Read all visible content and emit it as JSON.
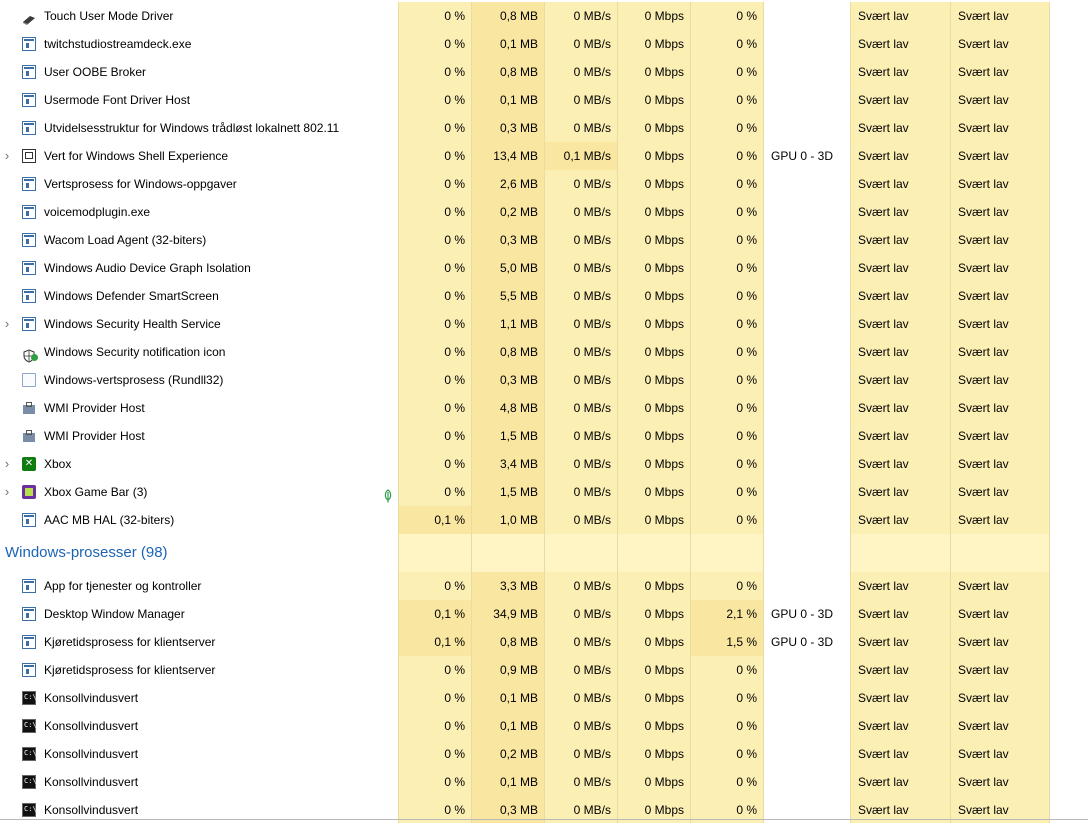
{
  "rows": [
    {
      "kind": "proc",
      "name": "Touch User Mode Driver",
      "icon": "pen-icon",
      "cpu": "0 %",
      "mem": "0,8 MB",
      "disk": "0 MB/s",
      "net": "0 Mbps",
      "gpu": "0 %",
      "engine": "",
      "power": "Svært lav",
      "power_trend": "Svært lav",
      "heat": [
        1,
        2,
        1,
        1,
        1
      ]
    },
    {
      "kind": "proc",
      "name": "twitchstudiostreamdeck.exe",
      "icon": "app-icon",
      "cpu": "0 %",
      "mem": "0,1 MB",
      "disk": "0 MB/s",
      "net": "0 Mbps",
      "gpu": "0 %",
      "engine": "",
      "power": "Svært lav",
      "power_trend": "Svært lav",
      "heat": [
        1,
        2,
        1,
        1,
        1
      ]
    },
    {
      "kind": "proc",
      "name": "User OOBE Broker",
      "icon": "app-icon",
      "cpu": "0 %",
      "mem": "0,8 MB",
      "disk": "0 MB/s",
      "net": "0 Mbps",
      "gpu": "0 %",
      "engine": "",
      "power": "Svært lav",
      "power_trend": "Svært lav",
      "heat": [
        1,
        2,
        1,
        1,
        1
      ]
    },
    {
      "kind": "proc",
      "name": "Usermode Font Driver Host",
      "icon": "app-icon",
      "cpu": "0 %",
      "mem": "0,1 MB",
      "disk": "0 MB/s",
      "net": "0 Mbps",
      "gpu": "0 %",
      "engine": "",
      "power": "Svært lav",
      "power_trend": "Svært lav",
      "heat": [
        1,
        2,
        1,
        1,
        1
      ]
    },
    {
      "kind": "proc",
      "name": "Utvidelsesstruktur for Windows trådløst lokalnett 802.11",
      "icon": "app-icon",
      "cpu": "0 %",
      "mem": "0,3 MB",
      "disk": "0 MB/s",
      "net": "0 Mbps",
      "gpu": "0 %",
      "engine": "",
      "power": "Svært lav",
      "power_trend": "Svært lav",
      "heat": [
        1,
        2,
        1,
        1,
        1
      ]
    },
    {
      "kind": "proc",
      "name": "Vert for Windows Shell Experience",
      "icon": "shell-icon",
      "chevron": true,
      "cpu": "0 %",
      "mem": "13,4 MB",
      "disk": "0,1 MB/s",
      "net": "0 Mbps",
      "gpu": "0 %",
      "engine": "GPU 0 - 3D",
      "power": "Svært lav",
      "power_trend": "Svært lav",
      "heat": [
        1,
        2,
        2,
        1,
        1
      ]
    },
    {
      "kind": "proc",
      "name": "Vertsprosess for Windows-oppgaver",
      "icon": "app-icon",
      "cpu": "0 %",
      "mem": "2,6 MB",
      "disk": "0 MB/s",
      "net": "0 Mbps",
      "gpu": "0 %",
      "engine": "",
      "power": "Svært lav",
      "power_trend": "Svært lav",
      "heat": [
        1,
        2,
        1,
        1,
        1
      ]
    },
    {
      "kind": "proc",
      "name": "voicemodplugin.exe",
      "icon": "app-icon",
      "cpu": "0 %",
      "mem": "0,2 MB",
      "disk": "0 MB/s",
      "net": "0 Mbps",
      "gpu": "0 %",
      "engine": "",
      "power": "Svært lav",
      "power_trend": "Svært lav",
      "heat": [
        1,
        2,
        1,
        1,
        1
      ]
    },
    {
      "kind": "proc",
      "name": "Wacom Load Agent (32-biters)",
      "icon": "app-icon",
      "cpu": "0 %",
      "mem": "0,3 MB",
      "disk": "0 MB/s",
      "net": "0 Mbps",
      "gpu": "0 %",
      "engine": "",
      "power": "Svært lav",
      "power_trend": "Svært lav",
      "heat": [
        1,
        2,
        1,
        1,
        1
      ]
    },
    {
      "kind": "proc",
      "name": "Windows Audio Device Graph Isolation",
      "icon": "app-icon",
      "cpu": "0 %",
      "mem": "5,0 MB",
      "disk": "0 MB/s",
      "net": "0 Mbps",
      "gpu": "0 %",
      "engine": "",
      "power": "Svært lav",
      "power_trend": "Svært lav",
      "heat": [
        1,
        2,
        1,
        1,
        1
      ]
    },
    {
      "kind": "proc",
      "name": "Windows Defender SmartScreen",
      "icon": "app-icon",
      "cpu": "0 %",
      "mem": "5,5 MB",
      "disk": "0 MB/s",
      "net": "0 Mbps",
      "gpu": "0 %",
      "engine": "",
      "power": "Svært lav",
      "power_trend": "Svært lav",
      "heat": [
        1,
        2,
        1,
        1,
        1
      ]
    },
    {
      "kind": "proc",
      "name": "Windows Security Health Service",
      "icon": "app-icon",
      "chevron": true,
      "cpu": "0 %",
      "mem": "1,1 MB",
      "disk": "0 MB/s",
      "net": "0 Mbps",
      "gpu": "0 %",
      "engine": "",
      "power": "Svært lav",
      "power_trend": "Svært lav",
      "heat": [
        1,
        2,
        1,
        1,
        1
      ]
    },
    {
      "kind": "proc",
      "name": "Windows Security notification icon",
      "icon": "shield-icon",
      "cpu": "0 %",
      "mem": "0,8 MB",
      "disk": "0 MB/s",
      "net": "0 Mbps",
      "gpu": "0 %",
      "engine": "",
      "power": "Svært lav",
      "power_trend": "Svært lav",
      "heat": [
        1,
        2,
        1,
        1,
        1
      ]
    },
    {
      "kind": "proc",
      "name": "Windows-vertsprosess (Rundll32)",
      "icon": "document-icon",
      "cpu": "0 %",
      "mem": "0,3 MB",
      "disk": "0 MB/s",
      "net": "0 Mbps",
      "gpu": "0 %",
      "engine": "",
      "power": "Svært lav",
      "power_trend": "Svært lav",
      "heat": [
        1,
        2,
        1,
        1,
        1
      ]
    },
    {
      "kind": "proc",
      "name": "WMI Provider Host",
      "icon": "wmi-icon",
      "cpu": "0 %",
      "mem": "4,8 MB",
      "disk": "0 MB/s",
      "net": "0 Mbps",
      "gpu": "0 %",
      "engine": "",
      "power": "Svært lav",
      "power_trend": "Svært lav",
      "heat": [
        1,
        2,
        1,
        1,
        1
      ]
    },
    {
      "kind": "proc",
      "name": "WMI Provider Host",
      "icon": "wmi-icon",
      "cpu": "0 %",
      "mem": "1,5 MB",
      "disk": "0 MB/s",
      "net": "0 Mbps",
      "gpu": "0 %",
      "engine": "",
      "power": "Svært lav",
      "power_trend": "Svært lav",
      "heat": [
        1,
        2,
        1,
        1,
        1
      ]
    },
    {
      "kind": "proc",
      "name": "Xbox",
      "icon": "xbox-icon",
      "chevron": true,
      "cpu": "0 %",
      "mem": "3,4 MB",
      "disk": "0 MB/s",
      "net": "0 Mbps",
      "gpu": "0 %",
      "engine": "",
      "power": "Svært lav",
      "power_trend": "Svært lav",
      "heat": [
        1,
        2,
        1,
        1,
        1
      ]
    },
    {
      "kind": "proc",
      "name": "Xbox Game Bar (3)",
      "icon": "game-bar-icon",
      "chevron": true,
      "leaf": true,
      "cpu": "0 %",
      "mem": "1,5 MB",
      "disk": "0 MB/s",
      "net": "0 Mbps",
      "gpu": "0 %",
      "engine": "",
      "power": "Svært lav",
      "power_trend": "Svært lav",
      "heat": [
        1,
        2,
        1,
        1,
        1
      ]
    },
    {
      "kind": "proc",
      "name": "AAC MB HAL (32-biters)",
      "icon": "app-icon",
      "cpu": "0,1 %",
      "mem": "1,0 MB",
      "disk": "0 MB/s",
      "net": "0 Mbps",
      "gpu": "0 %",
      "engine": "",
      "power": "Svært lav",
      "power_trend": "Svært lav",
      "heat": [
        2,
        2,
        1,
        1,
        1
      ]
    },
    {
      "kind": "group",
      "name": "Windows-prosesser (98)"
    },
    {
      "kind": "proc",
      "name": "App for tjenester og kontroller",
      "icon": "app-icon",
      "cpu": "0 %",
      "mem": "3,3 MB",
      "disk": "0 MB/s",
      "net": "0 Mbps",
      "gpu": "0 %",
      "engine": "",
      "power": "Svært lav",
      "power_trend": "Svært lav",
      "heat": [
        1,
        2,
        1,
        1,
        1
      ]
    },
    {
      "kind": "proc",
      "name": "Desktop Window Manager",
      "icon": "app-icon",
      "cpu": "0,1 %",
      "mem": "34,9 MB",
      "disk": "0 MB/s",
      "net": "0 Mbps",
      "gpu": "2,1 %",
      "engine": "GPU 0 - 3D",
      "power": "Svært lav",
      "power_trend": "Svært lav",
      "heat": [
        2,
        2,
        1,
        1,
        2
      ]
    },
    {
      "kind": "proc",
      "name": "Kjøretidsprosess for klientserver",
      "icon": "app-icon",
      "cpu": "0,1 %",
      "mem": "0,8 MB",
      "disk": "0 MB/s",
      "net": "0 Mbps",
      "gpu": "1,5 %",
      "engine": "GPU 0 - 3D",
      "power": "Svært lav",
      "power_trend": "Svært lav",
      "heat": [
        2,
        2,
        1,
        1,
        2
      ]
    },
    {
      "kind": "proc",
      "name": "Kjøretidsprosess for klientserver",
      "icon": "app-icon",
      "cpu": "0 %",
      "mem": "0,9 MB",
      "disk": "0 MB/s",
      "net": "0 Mbps",
      "gpu": "0 %",
      "engine": "",
      "power": "Svært lav",
      "power_trend": "Svært lav",
      "heat": [
        1,
        2,
        1,
        1,
        1
      ]
    },
    {
      "kind": "proc",
      "name": "Konsollvindusvert",
      "icon": "console-icon",
      "cpu": "0 %",
      "mem": "0,1 MB",
      "disk": "0 MB/s",
      "net": "0 Mbps",
      "gpu": "0 %",
      "engine": "",
      "power": "Svært lav",
      "power_trend": "Svært lav",
      "heat": [
        1,
        2,
        1,
        1,
        1
      ]
    },
    {
      "kind": "proc",
      "name": "Konsollvindusvert",
      "icon": "console-icon",
      "cpu": "0 %",
      "mem": "0,1 MB",
      "disk": "0 MB/s",
      "net": "0 Mbps",
      "gpu": "0 %",
      "engine": "",
      "power": "Svært lav",
      "power_trend": "Svært lav",
      "heat": [
        1,
        2,
        1,
        1,
        1
      ]
    },
    {
      "kind": "proc",
      "name": "Konsollvindusvert",
      "icon": "console-icon",
      "cpu": "0 %",
      "mem": "0,2 MB",
      "disk": "0 MB/s",
      "net": "0 Mbps",
      "gpu": "0 %",
      "engine": "",
      "power": "Svært lav",
      "power_trend": "Svært lav",
      "heat": [
        1,
        2,
        1,
        1,
        1
      ]
    },
    {
      "kind": "proc",
      "name": "Konsollvindusvert",
      "icon": "console-icon",
      "cpu": "0 %",
      "mem": "0,1 MB",
      "disk": "0 MB/s",
      "net": "0 Mbps",
      "gpu": "0 %",
      "engine": "",
      "power": "Svært lav",
      "power_trend": "Svært lav",
      "heat": [
        1,
        2,
        1,
        1,
        1
      ]
    },
    {
      "kind": "proc",
      "name": "Konsollvindusvert",
      "icon": "console-icon",
      "cpu": "0 %",
      "mem": "0,3 MB",
      "disk": "0 MB/s",
      "net": "0 Mbps",
      "gpu": "0 %",
      "engine": "",
      "power": "Svært lav",
      "power_trend": "Svært lav",
      "heat": [
        1,
        2,
        1,
        1,
        1
      ]
    }
  ],
  "colors": {
    "heat_low": "#fff4c4",
    "heat_mid": "#fcefb4",
    "heat_high": "#f9e6a0",
    "group_title": "#1c64b4",
    "grid_line": "#e8dca4"
  },
  "glyphs": {
    "chevron": "›"
  }
}
